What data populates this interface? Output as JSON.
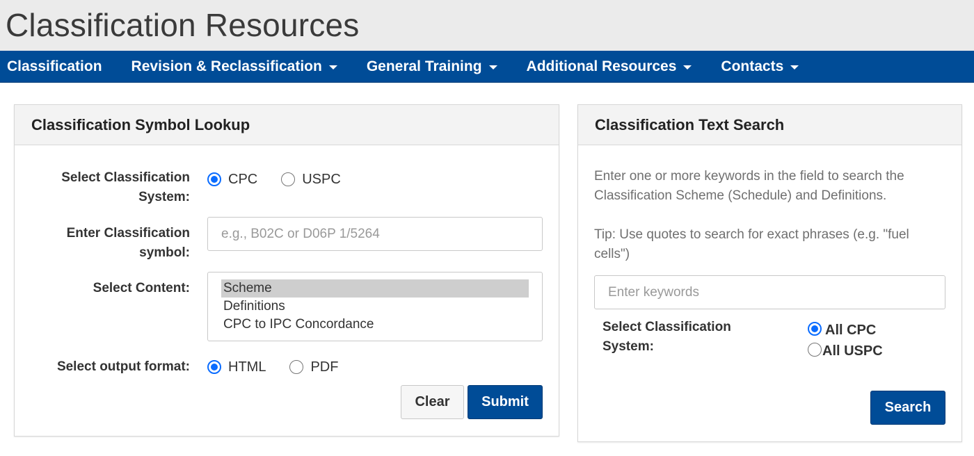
{
  "header": {
    "title": "Classification Resources"
  },
  "nav": {
    "items": [
      {
        "label": "Classification",
        "dropdown": false
      },
      {
        "label": "Revision & Reclassification",
        "dropdown": true
      },
      {
        "label": "General Training",
        "dropdown": true
      },
      {
        "label": "Additional Resources",
        "dropdown": true
      },
      {
        "label": "Contacts",
        "dropdown": true
      }
    ]
  },
  "colors": {
    "brand": "#004c97",
    "radio_accent": "#0a6cff",
    "header_bg": "#ebebeb"
  },
  "lookup": {
    "title": "Classification Symbol Lookup",
    "system_label_line1": "Select Classification",
    "system_label_line2": "System:",
    "system_options": [
      {
        "label": "CPC",
        "checked": true
      },
      {
        "label": "USPC",
        "checked": false
      }
    ],
    "symbol_label_line1": "Enter Classification",
    "symbol_label_line2": "symbol:",
    "symbol_input": {
      "value": "",
      "placeholder": "e.g., B02C or D06P 1/5264"
    },
    "content_label": "Select Content:",
    "content_options": [
      {
        "label": "Scheme",
        "selected": true
      },
      {
        "label": "Definitions",
        "selected": false
      },
      {
        "label": "CPC to IPC Concordance",
        "selected": false
      }
    ],
    "format_label": "Select output format:",
    "format_options": [
      {
        "label": "HTML",
        "checked": true
      },
      {
        "label": "PDF",
        "checked": false
      }
    ],
    "clear_label": "Clear",
    "submit_label": "Submit"
  },
  "textsearch": {
    "title": "Classification Text Search",
    "description": "Enter one or more keywords in the field to search the Classification Scheme (Schedule) and Definitions.",
    "tip": "Tip: Use quotes to search for exact phrases (e.g. \"fuel cells\")",
    "keywords_input": {
      "value": "",
      "placeholder": "Enter keywords"
    },
    "system_label_line1": "Select Classification",
    "system_label_line2": "System:",
    "system_options": [
      {
        "label": "All CPC",
        "checked": true
      },
      {
        "label": "All USPC",
        "checked": false
      }
    ],
    "search_label": "Search"
  }
}
